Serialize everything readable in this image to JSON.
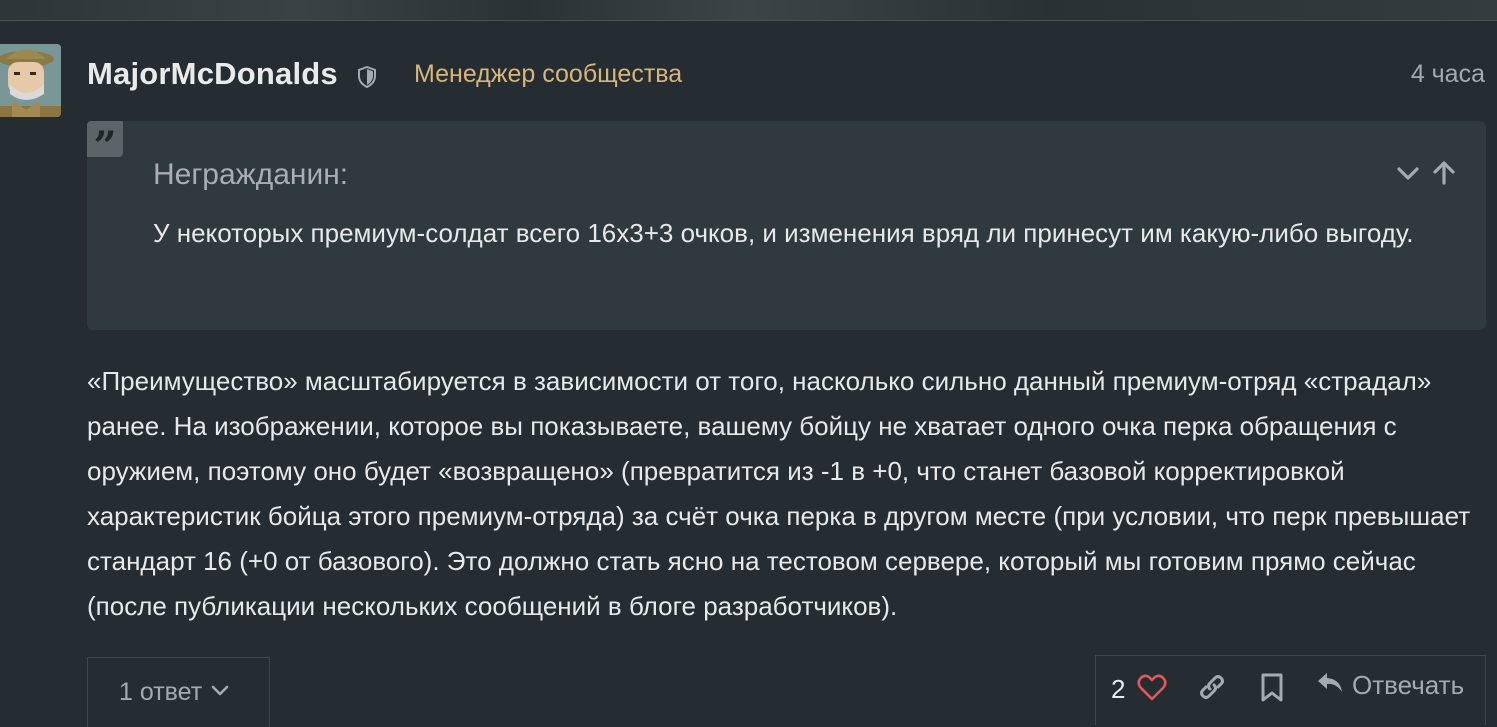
{
  "post": {
    "author": "MajorMcDonalds",
    "role": "Менеджер сообщества",
    "time": "4 часа",
    "quote": {
      "author": "Негражданин:",
      "text": "У некоторых премиум-солдат всего 16x3+3 очков, и изменения вряд ли принесут им какую-либо выгоду."
    },
    "body": "«Преимущество» масштабируется в зависимости от того, насколько сильно данный премиум-отряд «страдал» ранее. На изображении, которое вы показываете, вашему бойцу не хватает одного очка перка обращения с оружием, поэтому оно будет «возвращено» (превратится из -1 в +0, что станет базовой корректировкой характеристик бойца этого премиум-отряда) за счёт очка перка в другом месте (при условии, что перк превышает стандарт 16 (+0 от базового). Это должно стать ясно на тестовом сервере, который мы готовим прямо сейчас (после публикации нескольких сообщений в блоге разработчиков).",
    "replies_label": "1 ответ",
    "likes": "2",
    "reply_label": "Отвечать"
  },
  "icons": {
    "avatar": "avatar",
    "role_badge": "shield-icon",
    "quote": "quote-icon",
    "expand": "chevron-down-icon",
    "jump_to": "arrow-up-icon",
    "replies_toggle": "chevron-down-icon",
    "like": "heart-icon",
    "share": "link-icon",
    "bookmark": "bookmark-icon",
    "reply": "reply-icon"
  },
  "colors": {
    "background": "#252d32",
    "quote_background": "#2f393e",
    "role": "#d7b57b",
    "heart": "#e4575b",
    "muted": "#a4abaf"
  }
}
